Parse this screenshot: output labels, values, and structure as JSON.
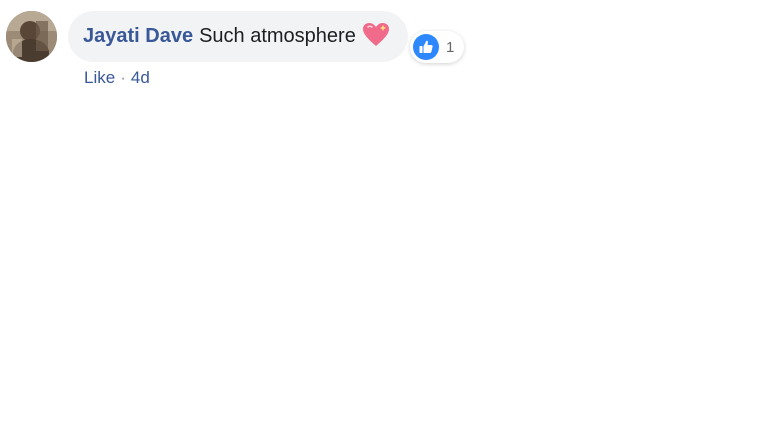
{
  "comment": {
    "author": "Jayati Dave",
    "text": "Such atmosphere",
    "emoji_icon": "sparkling-heart-icon",
    "reaction": {
      "icon": "thumbs-up-icon",
      "count": "1",
      "color": "#2d88ff"
    },
    "actions": {
      "like_label": "Like",
      "separator": "·",
      "timestamp": "4d"
    }
  },
  "colors": {
    "author": "#385898",
    "bubble": "#f2f3f5",
    "heart": "#f06b8a"
  }
}
